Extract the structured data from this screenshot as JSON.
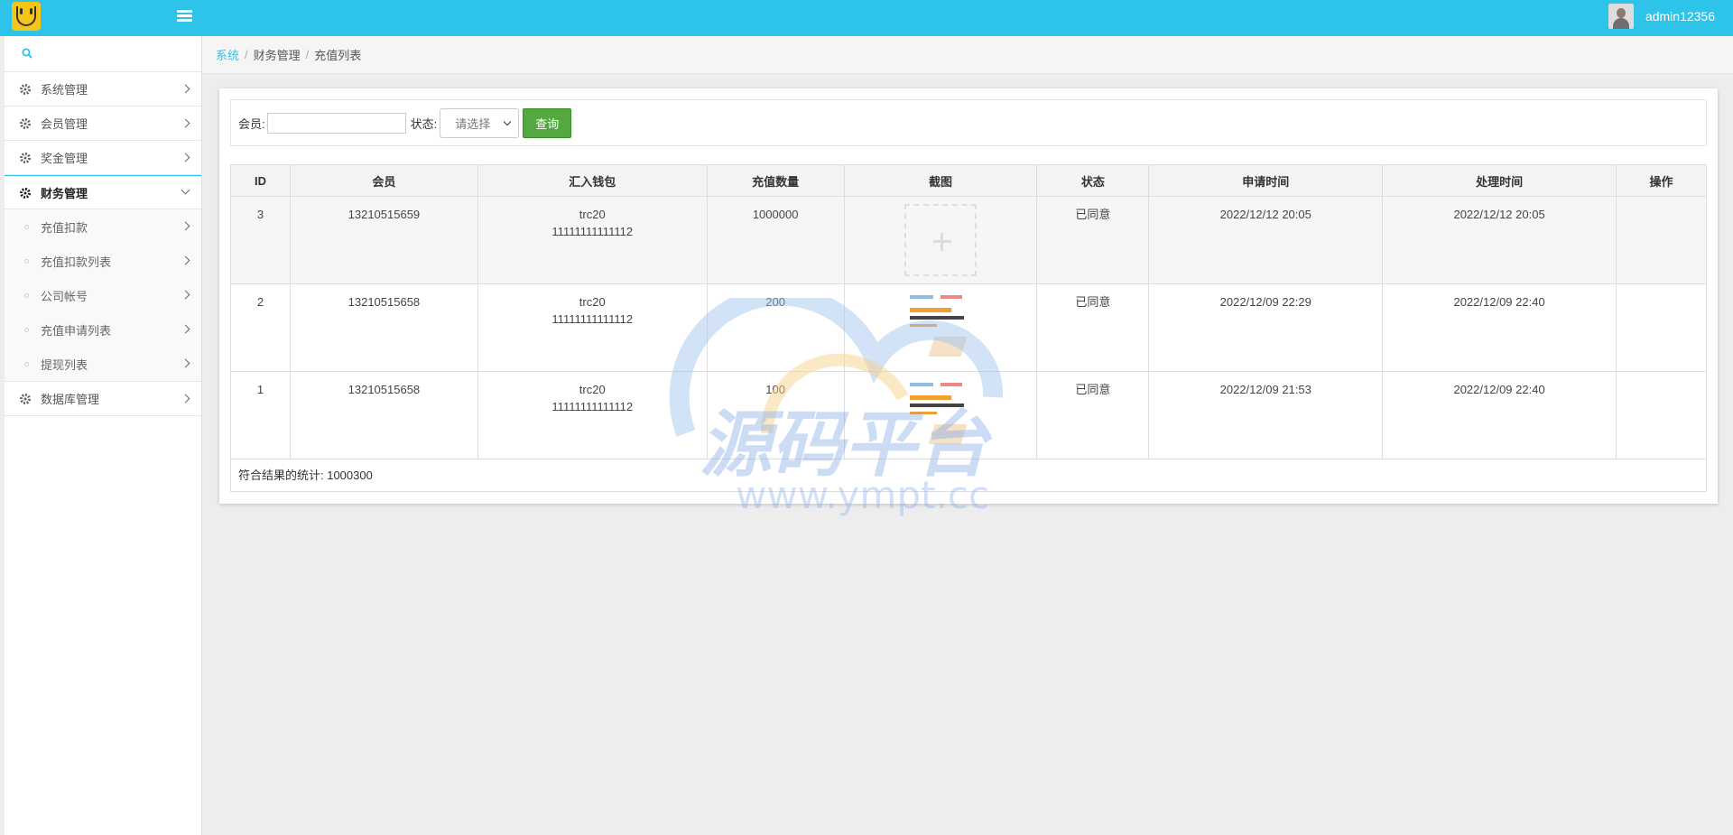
{
  "header": {
    "username": "admin12356"
  },
  "sidebar": {
    "items": [
      {
        "label": "系统管理"
      },
      {
        "label": "会员管理"
      },
      {
        "label": "奖金管理"
      },
      {
        "label": "财务管理"
      },
      {
        "label": "数据库管理"
      }
    ],
    "submenu": [
      {
        "label": "充值扣款"
      },
      {
        "label": "充值扣款列表"
      },
      {
        "label": "公司帐号"
      },
      {
        "label": "充值申请列表"
      },
      {
        "label": "提现列表"
      }
    ]
  },
  "breadcrumb": {
    "items": [
      "系统",
      "财务管理",
      "充值列表"
    ],
    "separator": "/"
  },
  "filter": {
    "member_label": "会员:",
    "member_value": "",
    "status_label": "状态:",
    "status_selected": "请选择",
    "query_button": "查询"
  },
  "table": {
    "columns": [
      "ID",
      "会员",
      "汇入钱包",
      "充值数量",
      "截图",
      "状态",
      "申请时间",
      "处理时间",
      "操作"
    ],
    "rows": [
      {
        "id": "3",
        "member": "13210515659",
        "wallet_type": "trc20",
        "wallet_addr": "11111111111112",
        "amount": "1000000",
        "screenshot": "upload-placeholder",
        "status": "已同意",
        "applied": "2022/12/12 20:05",
        "processed": "2022/12/12 20:05",
        "action": ""
      },
      {
        "id": "2",
        "member": "13210515658",
        "wallet_type": "trc20",
        "wallet_addr": "11111111111112",
        "amount": "200",
        "screenshot": "document-thumbnail",
        "status": "已同意",
        "applied": "2022/12/09 22:29",
        "processed": "2022/12/09 22:40",
        "action": ""
      },
      {
        "id": "1",
        "member": "13210515658",
        "wallet_type": "trc20",
        "wallet_addr": "11111111111112",
        "amount": "100",
        "screenshot": "document-thumbnail",
        "status": "已同意",
        "applied": "2022/12/09 21:53",
        "processed": "2022/12/09 22:40",
        "action": ""
      }
    ],
    "footer": "符合结果的统计: 1000300"
  },
  "watermark": {
    "line1": "源码平台",
    "line2": "www.ympt.cc"
  },
  "colors": {
    "topbar": "#2ec3e9",
    "button_green": "#53a93f",
    "link": "#2ec3e9"
  }
}
